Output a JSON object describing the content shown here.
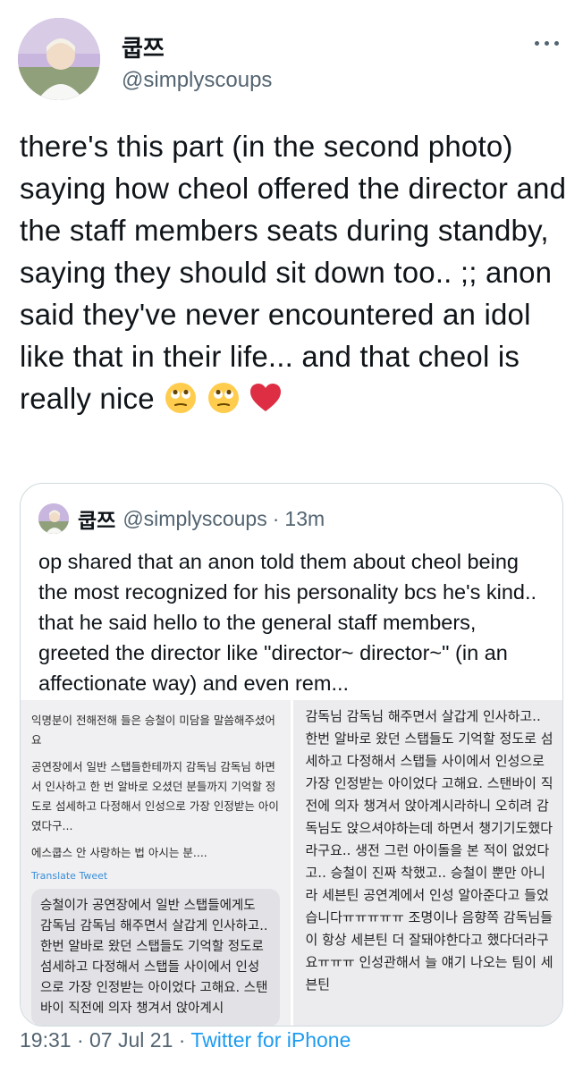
{
  "author": {
    "display_name": "쿱쯔",
    "username": "@simplyscoups"
  },
  "tweet": {
    "text": "there's this part (in the second photo) saying how cheol offered the director and the staff members seats during standby, saying they should sit down too.. ;; anon said they've never encountered an idol like that in their life... and that cheol is really nice",
    "emojis": [
      "face-with-rolling-eyes-icon",
      "face-with-rolling-eyes-icon",
      "red-heart-icon"
    ]
  },
  "quote": {
    "display_name": "쿱쯔",
    "username": "@simplyscoups",
    "separator": "·",
    "time": "13m",
    "text": "op shared that an anon told them about cheol being the most recognized for his personality bcs he's kind.. that he said hello to the general staff members, greeted the director like \"director~ director~\" (in an affectionate way) and even rem...",
    "image_left": {
      "para1": "익명분이 전해전해 들은 승철이 미담을 말씀해주셨어요",
      "para2": "공연장에서 일반 스탭들한테까지 감독님 감독님 하면서 인사하고 한 번 알바로 오셨던 분들까지 기억할 정도로 섬세하고 다정해서 인성으로 가장 인정받는 아이였다구...",
      "para3": "에스쿱스 안 사랑하는 법 아시는 분....",
      "translate_label": "Translate Tweet",
      "bubble": "승철이가 공연장에서 일반 스탭들에게도 감독님 감독님 해주면서 살갑게 인사하고.. 한번 알바로 왔던 스탭들도 기억할 정도로 섬세하고 다정해서 스탭들 사이에서 인성으로 가장 인정받는 아이었다 고해요. 스탠바이 직전에 의자 챙겨서 앉아계시"
    },
    "image_right": {
      "text": "감독님 감독님 해주면서 살갑게 인사하고.. 한번 알바로 왔던 스탭들도 기억할 정도로 섬세하고 다정해서 스탭들 사이에서 인성으로 가장 인정받는 아이었다 고해요. 스탠바이 직전에 의자 챙겨서 앉아계시라하니 오히려 감독님도 앉으셔야하는데 하면서 챙기기도했다라구요.. 생전 그런 아이돌을 본 적이 없었다고.. 승철이 진짜 착했고.. 승철이 뿐만 아니라 세븐틴 공연계에서 인성 알아준다고 들었습니다ㅠㅠㅠㅠㅠ 조명이나 음향쪽 감독님들이 항상 세븐틴 더 잘돼야한다고 했다더라구요ㅠㅠㅠ 인성관해서 늘 얘기 나오는 팀이 세븐틴"
    }
  },
  "footer": {
    "time": "19:31",
    "separator": "·",
    "date": "07 Jul 21",
    "separator2": "·",
    "client": "Twitter for iPhone"
  }
}
